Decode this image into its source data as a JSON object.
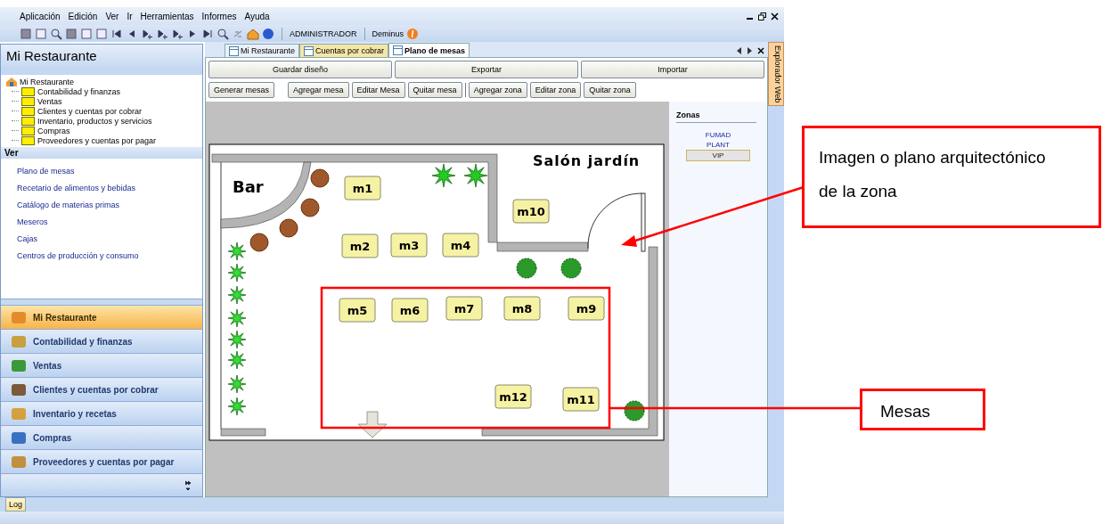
{
  "menu": [
    "Aplicación",
    "Edición",
    "Ver",
    "Ir",
    "Herramientas",
    "Informes",
    "Ayuda"
  ],
  "toolbar": {
    "user": "ADMINISTRADOR",
    "company": "Deminus"
  },
  "sidebar": {
    "title": "Mi Restaurante",
    "tree": {
      "label": "Mi Restaurante",
      "children": [
        {
          "label": "Contabilidad y finanzas"
        },
        {
          "label": "Ventas"
        },
        {
          "label": "Clientes y cuentas por cobrar"
        },
        {
          "label": "Inventario, productos y servicios"
        },
        {
          "label": "Compras"
        },
        {
          "label": "Proveedores y cuentas por pagar"
        }
      ]
    },
    "section": "Ver",
    "links": [
      "Plano de mesas",
      "Recetario de alimentos y bebidas",
      "Catálogo de materias primas",
      "Meseros",
      "Cajas",
      "Centros de producción y consumo"
    ],
    "nav": [
      {
        "label": "Mi Restaurante",
        "selected": true
      },
      {
        "label": "Contabilidad y finanzas",
        "selected": false
      },
      {
        "label": "Ventas",
        "selected": false
      },
      {
        "label": "Clientes y cuentas por cobrar",
        "selected": false
      },
      {
        "label": "Inventario y recetas",
        "selected": false
      },
      {
        "label": "Compras",
        "selected": false
      },
      {
        "label": "Proveedores y cuentas por pagar",
        "selected": false
      }
    ]
  },
  "tabs": [
    {
      "label": "Mi Restaurante",
      "selected": false
    },
    {
      "label": "Cuentas por cobrar",
      "selected": false
    },
    {
      "label": "Plano de mesas",
      "selected": true
    }
  ],
  "side_tab": "Explorador Web",
  "actions": [
    "Guardar diseño",
    "Exportar",
    "Importar"
  ],
  "tool_groups": [
    [
      "Generar mesas"
    ],
    [
      "Agregar mesa",
      "Editar Mesa",
      "Quitar mesa"
    ],
    [
      "Agregar zona",
      "Editar zona",
      "Quitar zona"
    ]
  ],
  "plan": {
    "title": "Salón jardín",
    "bar_label": "Bar",
    "tables": [
      "m1",
      "m2",
      "m3",
      "m4",
      "m5",
      "m6",
      "m7",
      "m8",
      "m9",
      "m10",
      "m11",
      "m12"
    ]
  },
  "zones": {
    "title": "Zonas",
    "items": [
      {
        "label": "FUMAD",
        "selected": false
      },
      {
        "label": "PLANT",
        "selected": false
      },
      {
        "label": "VIP",
        "selected": true
      }
    ]
  },
  "bottom_tabs": [
    {
      "label": "Log",
      "selected": true
    }
  ],
  "annotations": [
    "Imagen o plano arquitectónico de la zona",
    "Mesas"
  ]
}
